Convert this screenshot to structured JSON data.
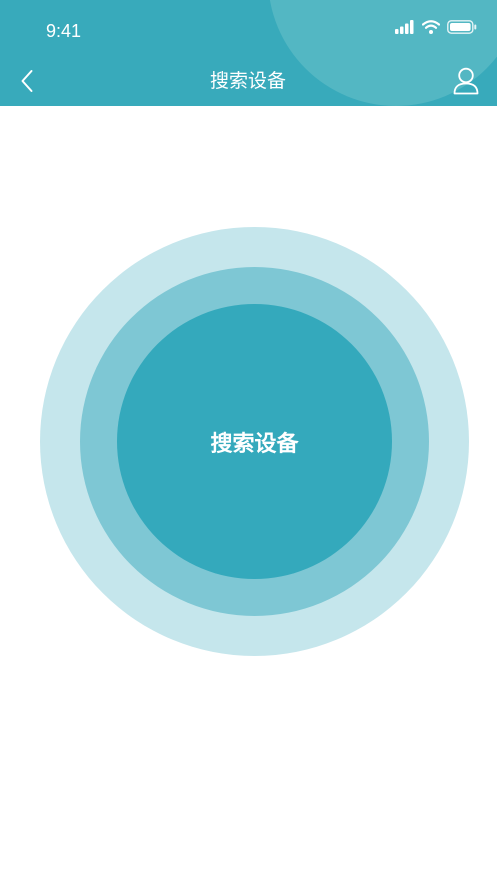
{
  "status_bar": {
    "time": "9:41",
    "icons": [
      "signal-icon",
      "wifi-icon",
      "battery-icon"
    ]
  },
  "nav": {
    "title": "搜索设备",
    "back_icon": "chevron-left-icon",
    "profile_icon": "user-icon"
  },
  "search": {
    "button_label": "搜索设备"
  },
  "colors": {
    "header": "#38aabb",
    "ring_outer": "#c5e6ec",
    "ring_middle": "#7ec7d4",
    "ring_inner": "#34a9bc",
    "text_on_accent": "#ffffff"
  }
}
